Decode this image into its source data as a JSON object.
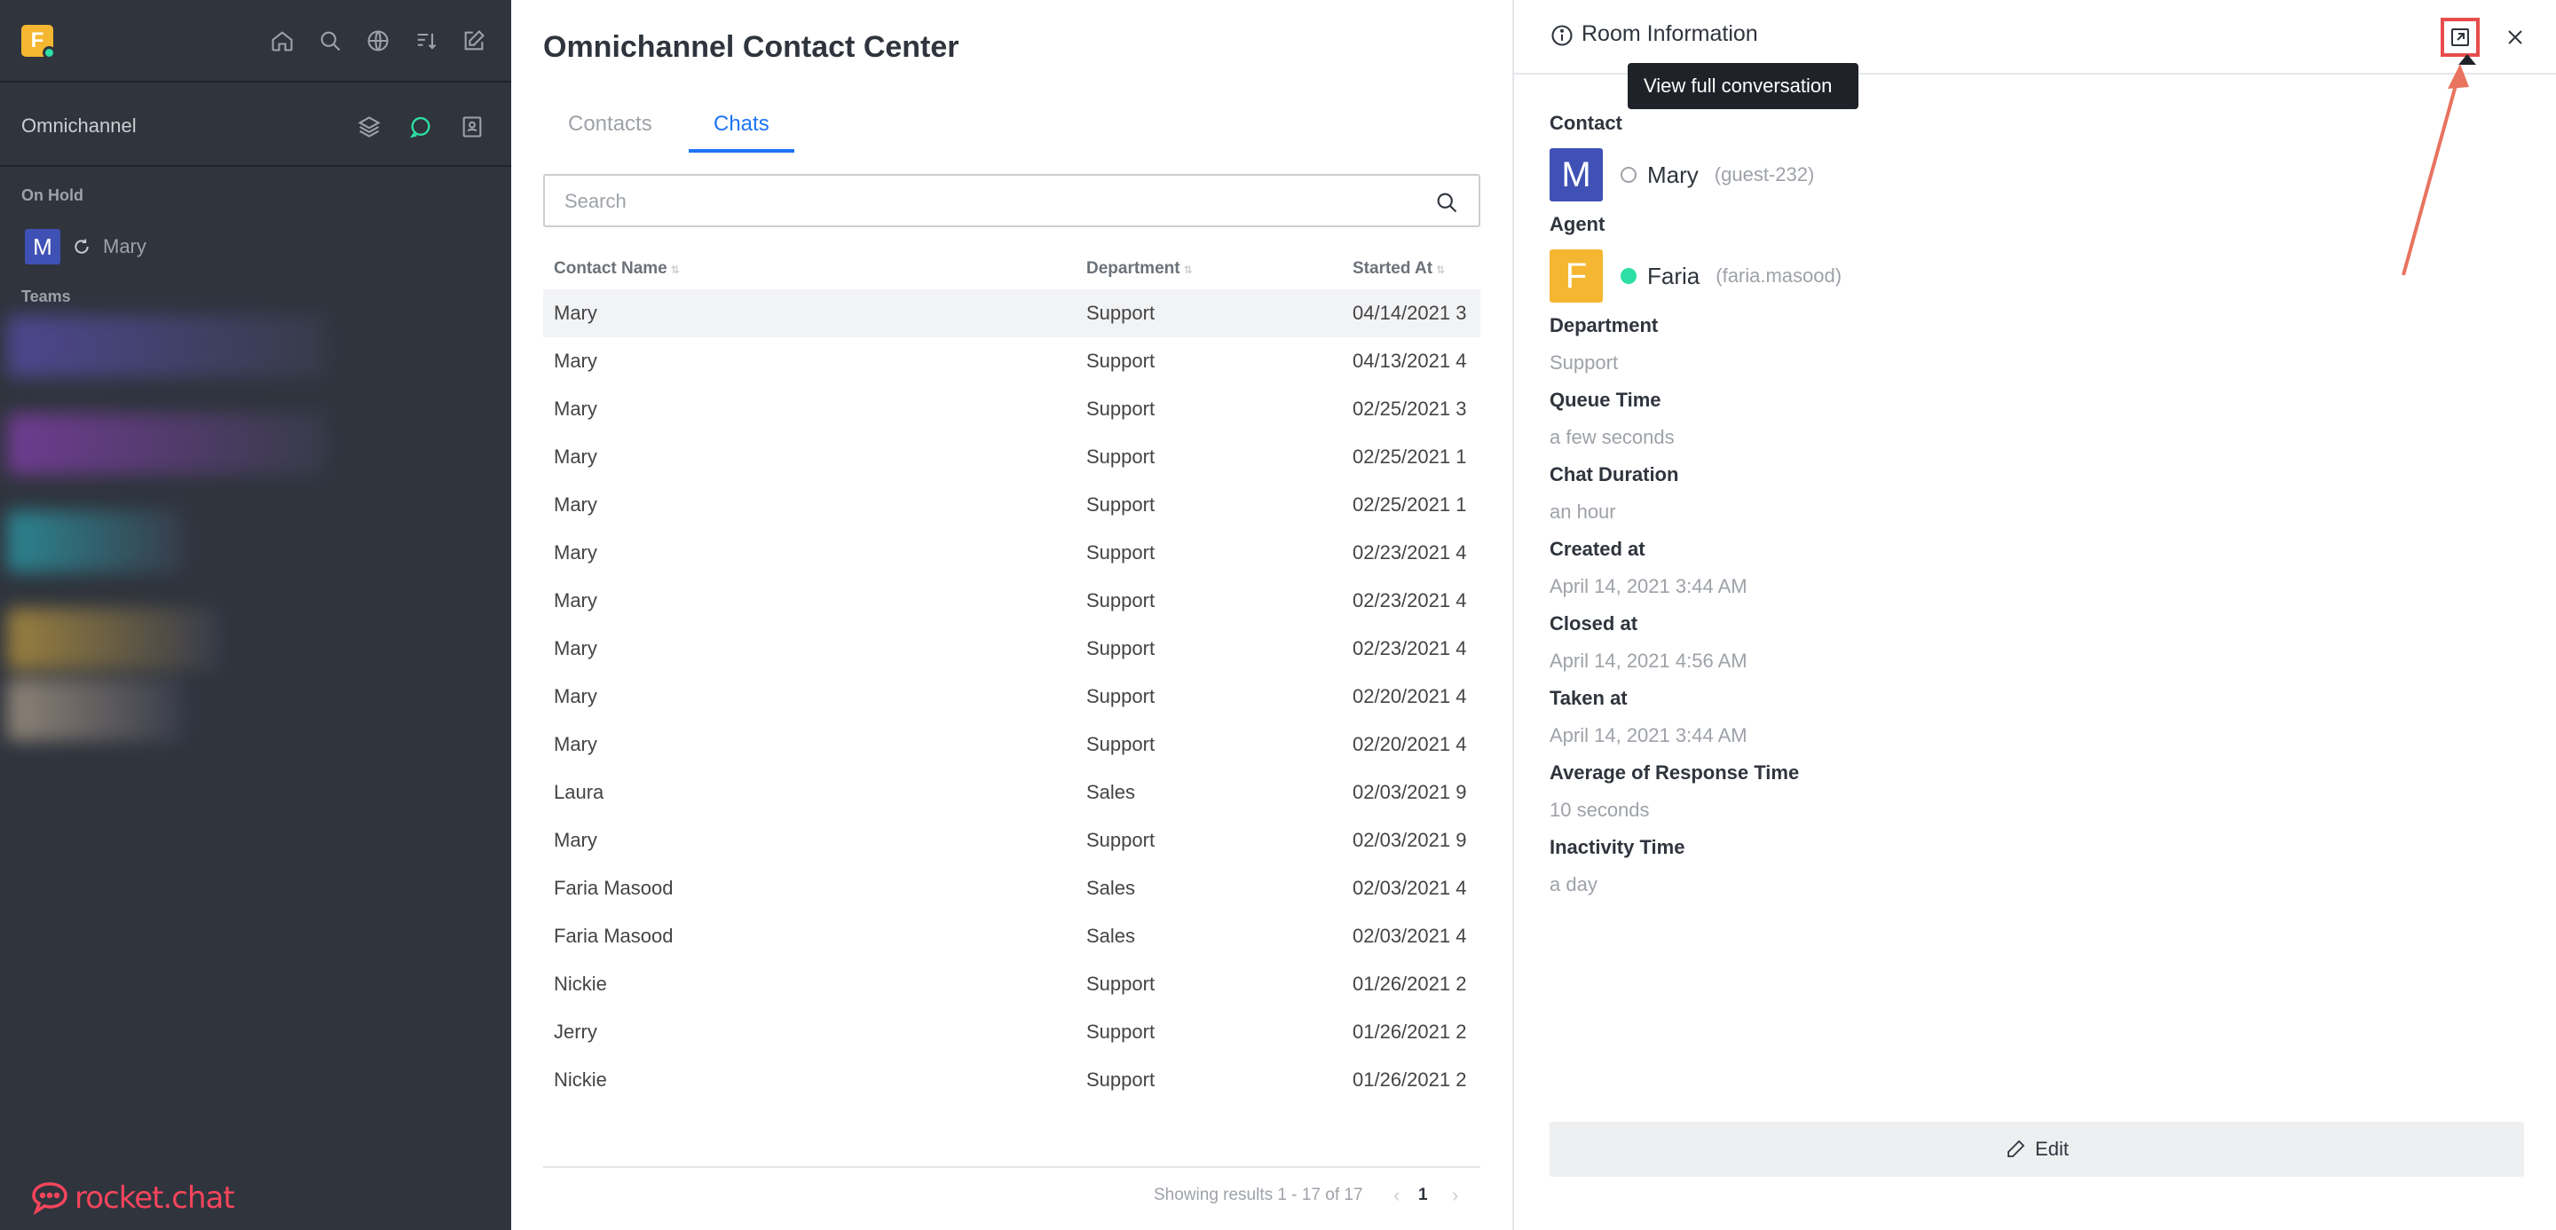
{
  "sidebar": {
    "logo_letter": "F",
    "omnichannel_label": "Omnichannel",
    "on_hold_label": "On Hold",
    "on_hold_room": {
      "avatar": "M",
      "name": "Mary"
    },
    "teams_label": "Teams",
    "footer_brand": "rocket.chat",
    "header_icons": [
      "home-icon",
      "search-icon",
      "directory-globe-icon",
      "sort-icon",
      "create-new-icon"
    ],
    "omni_icons": [
      "queue-stack-icon",
      "contact-center-chat-icon",
      "contacts-book-icon"
    ]
  },
  "main": {
    "title": "Omnichannel Contact Center",
    "tabs": [
      {
        "label": "Contacts",
        "active": false
      },
      {
        "label": "Chats",
        "active": true
      }
    ],
    "search": {
      "placeholder": "Search",
      "value": ""
    },
    "columns": [
      "Contact Name",
      "Department",
      "Started At"
    ],
    "rows": [
      {
        "name": "Mary",
        "department": "Support",
        "started": "04/14/2021 3"
      },
      {
        "name": "Mary",
        "department": "Support",
        "started": "04/13/2021 4"
      },
      {
        "name": "Mary",
        "department": "Support",
        "started": "02/25/2021 3"
      },
      {
        "name": "Mary",
        "department": "Support",
        "started": "02/25/2021 1"
      },
      {
        "name": "Mary",
        "department": "Support",
        "started": "02/25/2021 1"
      },
      {
        "name": "Mary",
        "department": "Support",
        "started": "02/23/2021 4"
      },
      {
        "name": "Mary",
        "department": "Support",
        "started": "02/23/2021 4"
      },
      {
        "name": "Mary",
        "department": "Support",
        "started": "02/23/2021 4"
      },
      {
        "name": "Mary",
        "department": "Support",
        "started": "02/20/2021 4"
      },
      {
        "name": "Mary",
        "department": "Support",
        "started": "02/20/2021 4"
      },
      {
        "name": "Laura",
        "department": "Sales",
        "started": "02/03/2021 9"
      },
      {
        "name": "Mary",
        "department": "Support",
        "started": "02/03/2021 9"
      },
      {
        "name": "Faria Masood",
        "department": "Sales",
        "started": "02/03/2021 4"
      },
      {
        "name": "Faria Masood",
        "department": "Sales",
        "started": "02/03/2021 4"
      },
      {
        "name": "Nickie",
        "department": "Support",
        "started": "01/26/2021 2"
      },
      {
        "name": "Jerry",
        "department": "Support",
        "started": "01/26/2021 2"
      },
      {
        "name": "Nickie",
        "department": "Support",
        "started": "01/26/2021 2"
      }
    ],
    "pagination": {
      "summary": "Showing results 1 - 17 of 17",
      "page": "1"
    }
  },
  "panel": {
    "title": "Room Information",
    "tooltip": "View full conversation",
    "contact_label": "Contact",
    "contact": {
      "avatar": "M",
      "name": "Mary",
      "username": "(guest-232)"
    },
    "agent_label": "Agent",
    "agent": {
      "avatar": "F",
      "name": "Faria",
      "username": "(faria.masood)"
    },
    "fields": [
      {
        "label": "Department",
        "value": "Support"
      },
      {
        "label": "Queue Time",
        "value": "a few seconds"
      },
      {
        "label": "Chat Duration",
        "value": "an hour"
      },
      {
        "label": "Created at",
        "value": "April 14, 2021 3:44 AM"
      },
      {
        "label": "Closed at",
        "value": "April 14, 2021 4:56 AM"
      },
      {
        "label": "Taken at",
        "value": "April 14, 2021 3:44 AM"
      },
      {
        "label": "Average of Response Time",
        "value": "10 seconds"
      },
      {
        "label": "Inactivity Time",
        "value": "a day"
      }
    ],
    "edit_label": "Edit"
  },
  "colors": {
    "sidebar_bg": "#2f343d",
    "accent_blue": "#1d74f5",
    "brand_red": "#f5455c",
    "online_green": "#2de0a5",
    "contact_avatar": "#3f51b5",
    "agent_avatar": "#f5b731",
    "highlight_red": "#e84b4b"
  }
}
